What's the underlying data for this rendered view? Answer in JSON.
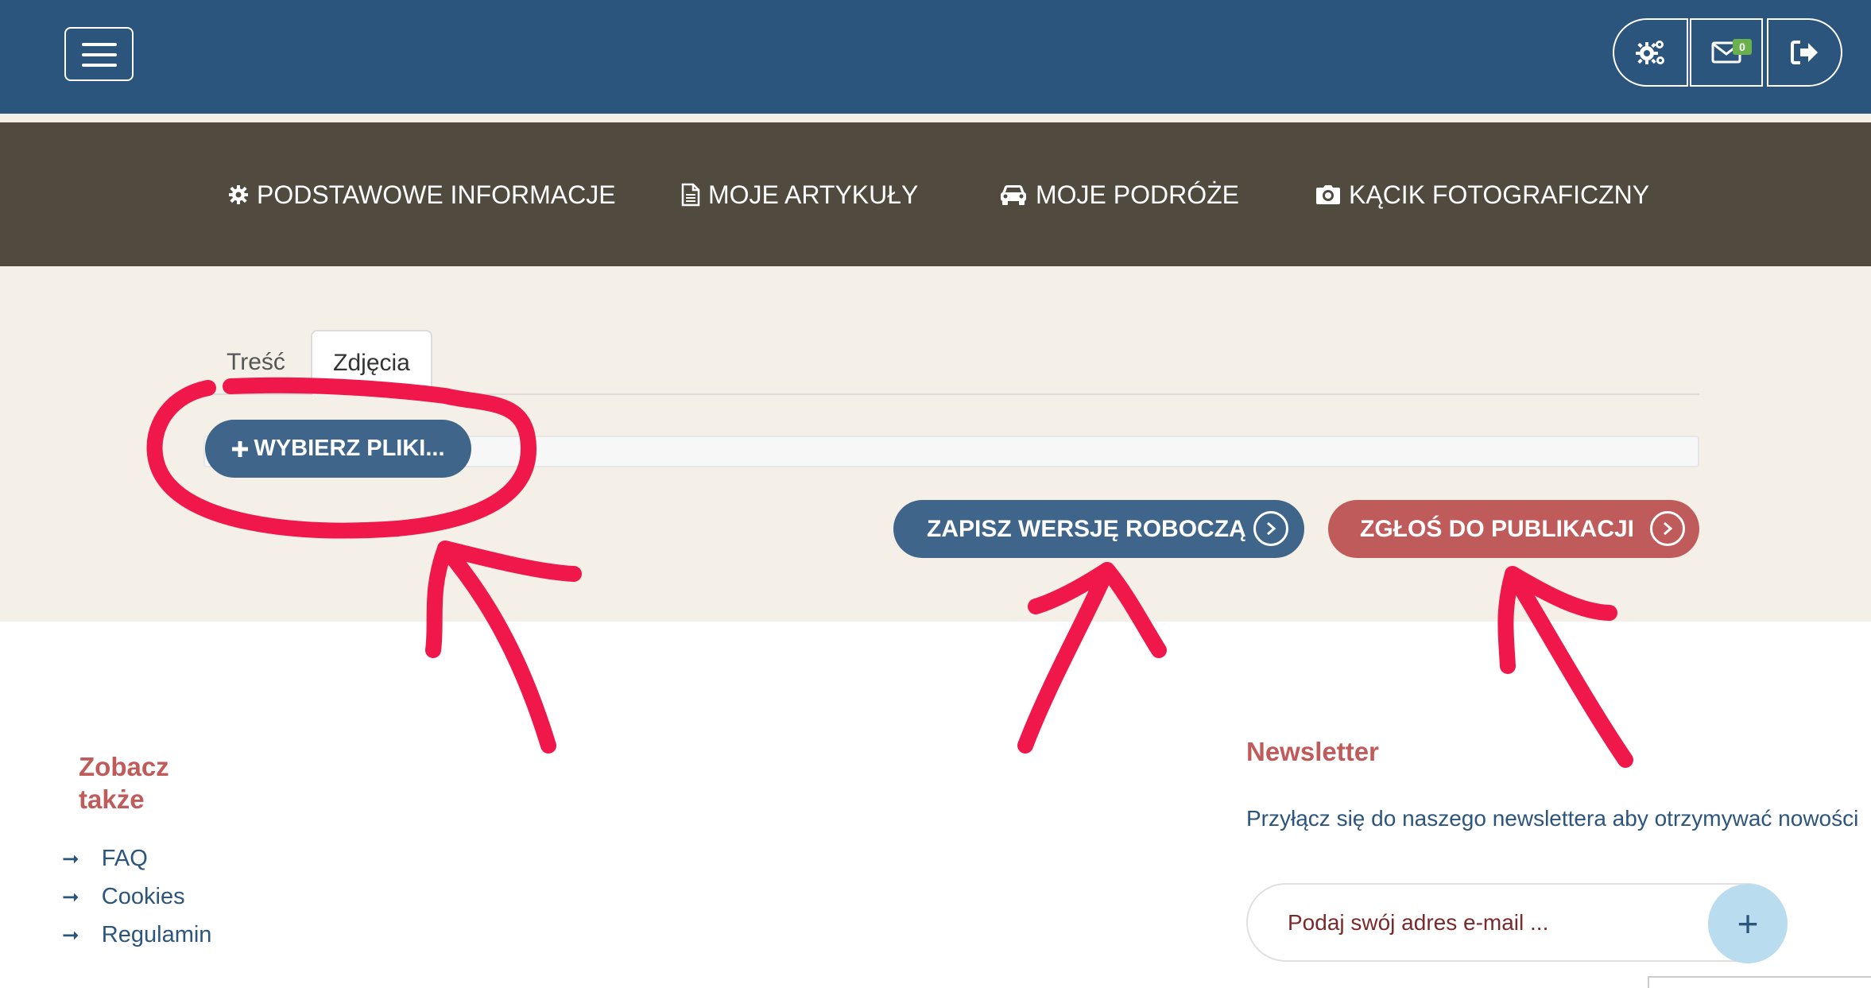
{
  "header": {
    "menu_icon": "hamburger-menu-icon",
    "actions": [
      {
        "icon": "gears-icon"
      },
      {
        "icon": "envelope-icon",
        "badge": "0"
      },
      {
        "icon": "sign-out-icon"
      }
    ],
    "bar_color": "#2c557d"
  },
  "nav": {
    "bar_color": "#514a3f",
    "items": [
      {
        "icon": "cog-icon",
        "label": "PODSTAWOWE INFORMACJE"
      },
      {
        "icon": "document-icon",
        "label": "MOJE ARTYKUŁY"
      },
      {
        "icon": "car-icon",
        "label": "MOJE PODRÓŻE"
      },
      {
        "icon": "camera-icon",
        "label": "KĄCIK FOTOGRAFICZNY"
      }
    ]
  },
  "editor": {
    "tabs": [
      {
        "label": "Treść",
        "active": false
      },
      {
        "label": "Zdjęcia",
        "active": true
      }
    ],
    "choose_files_label": "WYBIERZ PLIKI...",
    "save_draft_label": "ZAPISZ WERSJĘ ROBOCZĄ",
    "submit_label": "ZGŁOŚ DO PUBLIKACJI",
    "primary_color": "#3f668a",
    "accent_color": "#c05b5b"
  },
  "footer": {
    "see_also": {
      "title": "Zobacz także",
      "links": [
        "FAQ",
        "Cookies",
        "Regulamin"
      ]
    },
    "newsletter": {
      "title": "Newsletter",
      "description": "Przyłącz się do naszego newslettera aby otrzymywać nowości",
      "email_placeholder": "Podaj swój adres e-mail ..."
    }
  },
  "annotations": {
    "color": "#f0174a"
  }
}
